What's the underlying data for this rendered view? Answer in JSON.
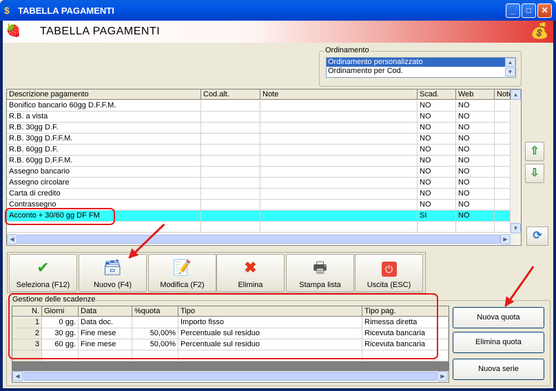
{
  "window": {
    "title": "TABELLA PAGAMENTI",
    "minimize_glyph": "_",
    "maximize_glyph": "□",
    "close_glyph": "✕"
  },
  "header": {
    "title": "TABELLA PAGAMENTI"
  },
  "ordering": {
    "label": "Ordinamento",
    "options": [
      "Ordinamento personalizzato",
      "Ordinamento per Cod."
    ],
    "selected": "Ordinamento personalizzato"
  },
  "payments": {
    "columns": [
      "Descrizione pagamento",
      "Cod.alt.",
      "Note",
      "Scad.",
      "Web",
      "Note"
    ],
    "rows": [
      {
        "desc": "Bonifico bancario 60gg D.F.F.M.",
        "cod": "",
        "note": "",
        "scad": "NO",
        "web": "NO"
      },
      {
        "desc": "R.B. a vista",
        "cod": "",
        "note": "",
        "scad": "NO",
        "web": "NO"
      },
      {
        "desc": "R.B. 30gg D.F.",
        "cod": "",
        "note": "",
        "scad": "NO",
        "web": "NO"
      },
      {
        "desc": "R.B. 30gg D.F.F.M.",
        "cod": "",
        "note": "",
        "scad": "NO",
        "web": "NO"
      },
      {
        "desc": "R.B. 60gg D.F.",
        "cod": "",
        "note": "",
        "scad": "NO",
        "web": "NO"
      },
      {
        "desc": "R.B. 60gg D.F.F.M.",
        "cod": "",
        "note": "",
        "scad": "NO",
        "web": "NO"
      },
      {
        "desc": "Assegno bancario",
        "cod": "",
        "note": "",
        "scad": "NO",
        "web": "NO"
      },
      {
        "desc": "Assegno circolare",
        "cod": "",
        "note": "",
        "scad": "NO",
        "web": "NO"
      },
      {
        "desc": "Carta di credito",
        "cod": "",
        "note": "",
        "scad": "NO",
        "web": "NO"
      },
      {
        "desc": "Contrassegno",
        "cod": "",
        "note": "",
        "scad": "NO",
        "web": "NO"
      },
      {
        "desc": "Acconto + 30/60 gg DF FM",
        "cod": "",
        "note": "",
        "scad": "SI",
        "web": "NO"
      }
    ],
    "highlight_color": "#33ffff"
  },
  "toolbar": {
    "select": "Seleziona (F12)",
    "new": "Nuovo (F4)",
    "edit": "Modifica (F2)",
    "delete": "Elimina",
    "print": "Stampa lista",
    "exit": "Uscita (ESC)"
  },
  "deadlines": {
    "label": "Gestione delle scadenze",
    "columns": [
      "N.",
      "Giorni",
      "Data",
      "%quota",
      "Tipo",
      "Tipo pag."
    ],
    "rows": [
      {
        "n": "1",
        "giorni": "0 gg.",
        "data": "Data doc.",
        "quota": "",
        "tipo": "Importo fisso",
        "tipopag": "Rimessa diretta"
      },
      {
        "n": "2",
        "giorni": "30 gg.",
        "data": "Fine mese",
        "quota": "50,00%",
        "tipo": "Percentuale sul residuo",
        "tipopag": "Ricevuta bancaria"
      },
      {
        "n": "3",
        "giorni": "60 gg.",
        "data": "Fine mese",
        "quota": "50,00%",
        "tipo": "Percentuale sul residuo",
        "tipopag": "Ricevuta bancaria"
      }
    ]
  },
  "side_buttons": {
    "new_quota": "Nuova quota",
    "delete_quota": "Elimina quota",
    "new_series": "Nuova serie"
  },
  "annotation_color": "#e31b1b"
}
